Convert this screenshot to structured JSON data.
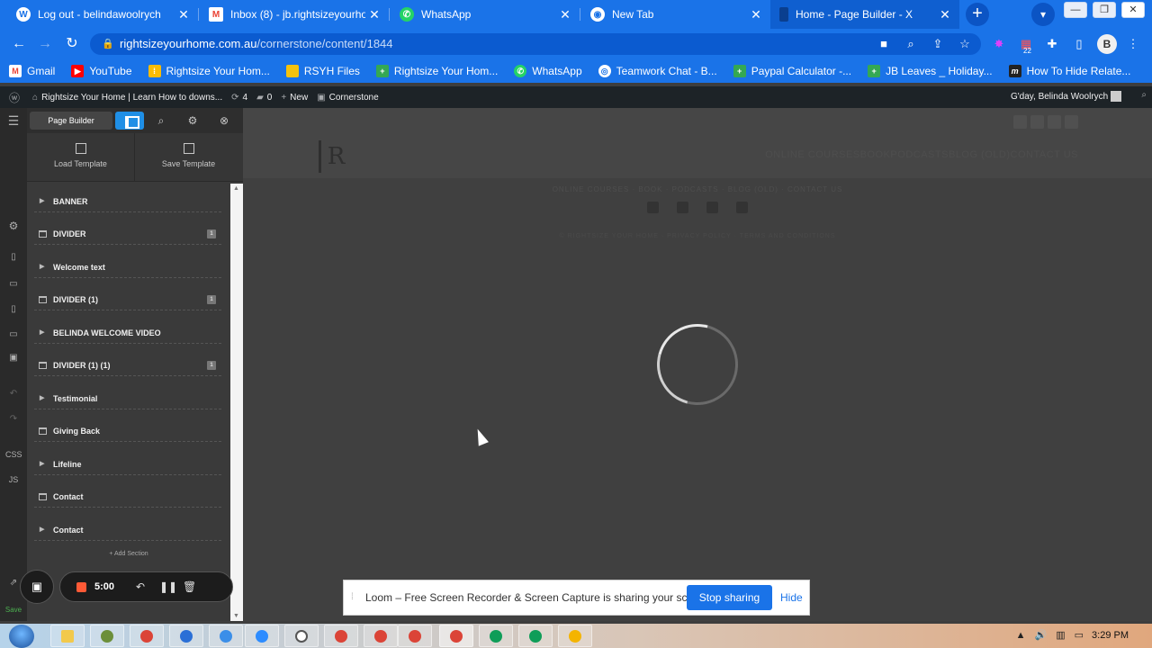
{
  "browser": {
    "tabs": [
      {
        "title": "Log out - belindawoolrych",
        "icon": "wordpress-icon",
        "active": false
      },
      {
        "title": "Inbox (8) - jb.rightsizeyourhom",
        "icon": "gmail-icon",
        "active": false
      },
      {
        "title": "WhatsApp",
        "icon": "whatsapp-icon",
        "active": false
      },
      {
        "title": "New Tab",
        "icon": "chrome-icon",
        "active": false
      },
      {
        "title": "Home - Page Builder - X",
        "icon": "cornerstone-icon",
        "active": true
      }
    ],
    "url_domain": "rightsizeyourhome.com.au",
    "url_path": "/cornerstone/content/1844",
    "extension_badge": "22",
    "bookmarks": [
      {
        "label": "Gmail",
        "icon": "gmail-icon",
        "color": "#ea4335"
      },
      {
        "label": "YouTube",
        "icon": "youtube-icon",
        "color": "#ff0000"
      },
      {
        "label": "Rightsize Your Hom...",
        "icon": "sheet-icon",
        "color": "#fbbc04"
      },
      {
        "label": "RSYH Files",
        "icon": "folder-icon",
        "color": "#f4c20d"
      },
      {
        "label": "Rightsize Your Hom...",
        "icon": "sheet-plus-icon",
        "color": "#34a853"
      },
      {
        "label": "WhatsApp",
        "icon": "whatsapp-icon",
        "color": "#25d366"
      },
      {
        "label": "Teamwork Chat - B...",
        "icon": "teamwork-icon",
        "color": "#ffffff"
      },
      {
        "label": "Paypal Calculator -...",
        "icon": "sheet-plus-icon",
        "color": "#34a853"
      },
      {
        "label": "JB Leaves _ Holiday...",
        "icon": "sheet-plus-icon",
        "color": "#34a853"
      },
      {
        "label": "How To Hide Relate...",
        "icon": "medium-icon",
        "color": "#222222"
      }
    ]
  },
  "wp_admin": {
    "site": "Rightsize Your Home | Learn How to downs...",
    "updates": "4",
    "comments": "0",
    "new_label": "New",
    "cornerstone_label": "Cornerstone",
    "greeting": "G'day, Belinda Woolrych"
  },
  "builder": {
    "tab_label": "Page Builder",
    "load_template": "Load Template",
    "save_template": "Save Template",
    "rail_css": "CSS",
    "rail_js": "JS",
    "save_label": "Save",
    "add_section": "+ Add Section",
    "layers": [
      {
        "label": "BANNER",
        "kind": "section",
        "count": ""
      },
      {
        "label": "DIVIDER",
        "kind": "element",
        "count": "1"
      },
      {
        "label": "Welcome text",
        "kind": "section",
        "count": ""
      },
      {
        "label": "DIVIDER (1)",
        "kind": "element",
        "count": "1"
      },
      {
        "label": "BELINDA WELCOME VIDEO",
        "kind": "section",
        "count": ""
      },
      {
        "label": "DIVIDER (1) (1)",
        "kind": "element",
        "count": "1"
      },
      {
        "label": "Testimonial",
        "kind": "section",
        "count": ""
      },
      {
        "label": "Giving Back",
        "kind": "element",
        "count": ""
      },
      {
        "label": "Lifeline",
        "kind": "section",
        "count": ""
      },
      {
        "label": "Contact",
        "kind": "element",
        "count": ""
      },
      {
        "label": "Contact",
        "kind": "section",
        "count": ""
      }
    ]
  },
  "preview": {
    "logo_letter": "R",
    "nav": "ONLINE COURSESBOOKPODCASTSBLOG (OLD)CONTACT US",
    "footer_links": "ONLINE COURSES · BOOK · PODCASTS · BLOG (OLD) · CONTACT US",
    "footer_legal": "© RIGHTSIZE YOUR HOME · PRIVACY POLICY · TERMS AND CONDITIONS"
  },
  "loom": {
    "timer": "5:00",
    "share_message": "Loom – Free Screen Recorder & Screen Capture is sharing your screen.",
    "stop_label": "Stop sharing",
    "hide_label": "Hide"
  },
  "taskbar": {
    "clock": "3:29 PM"
  }
}
